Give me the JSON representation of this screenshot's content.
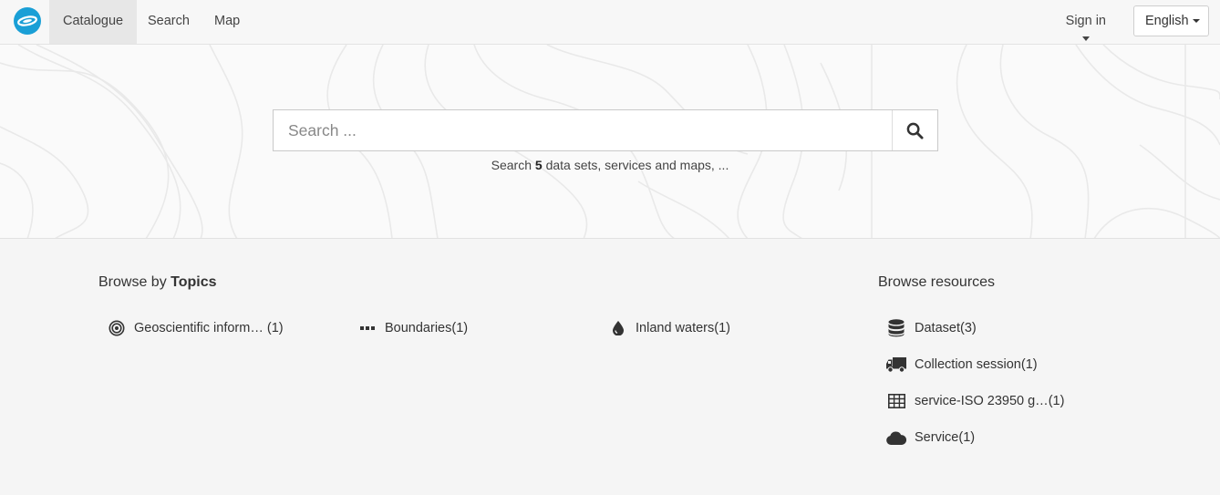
{
  "navbar": {
    "items": [
      {
        "label": "Catalogue",
        "active": true
      },
      {
        "label": "Search"
      },
      {
        "label": "Map"
      }
    ],
    "signin_label": "Sign in",
    "language": "English"
  },
  "hero": {
    "search_placeholder": "Search ...",
    "hint_prefix": "Search ",
    "hint_count": "5",
    "hint_suffix": " data sets, services and maps, ..."
  },
  "topics": {
    "title_prefix": "Browse by ",
    "title_bold": "Topics",
    "items": [
      {
        "label": "Geoscientific inform…",
        "count": "(1)",
        "icon": "bullseye-icon"
      },
      {
        "label": "Boundaries",
        "count": "(1)",
        "icon": "ellipsis-icon"
      },
      {
        "label": "Inland waters",
        "count": "(1)",
        "icon": "tint-icon"
      }
    ]
  },
  "resources": {
    "title": "Browse resources",
    "items": [
      {
        "label": "Dataset",
        "count": "(3)",
        "icon": "database-icon"
      },
      {
        "label": "Collection session",
        "count": "(1)",
        "icon": "truck-icon"
      },
      {
        "label": "service-ISO 23950 g…",
        "count": " (1)",
        "icon": "table-icon"
      },
      {
        "label": "Service",
        "count": "(1)",
        "icon": "cloud-icon"
      }
    ]
  },
  "colors": {
    "brand": "#1a9fd6",
    "navbar_bg": "#f7f7f7",
    "active_tab_bg": "#e7e7e7",
    "page_bg": "#f5f5f5"
  }
}
